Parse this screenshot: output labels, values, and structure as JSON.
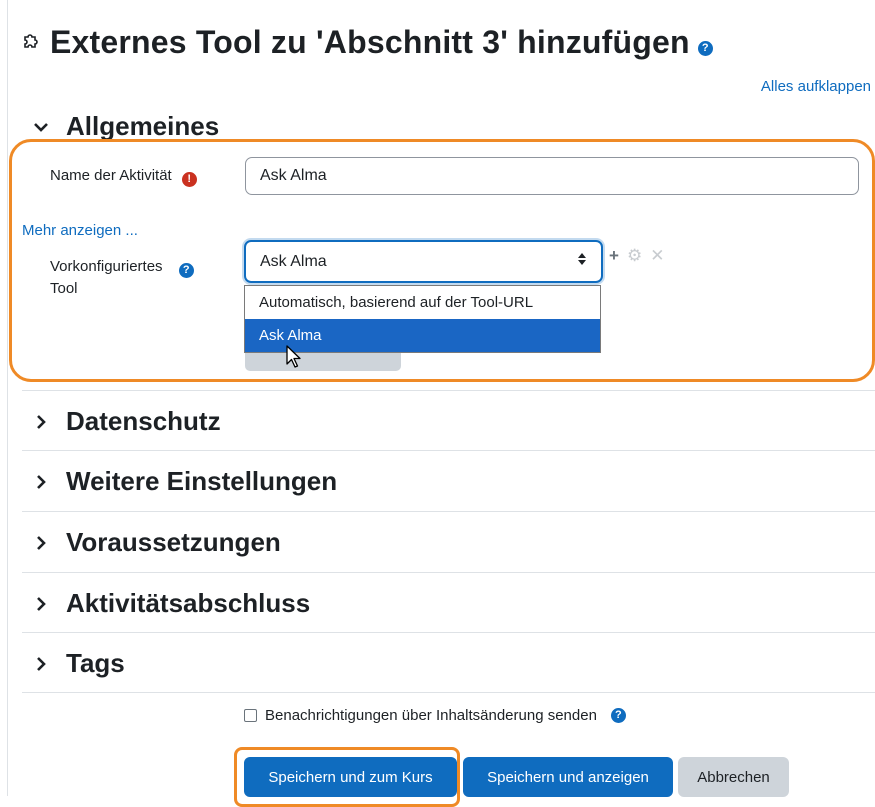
{
  "page": {
    "title": "Externes Tool zu 'Abschnitt 3' hinzufügen",
    "expand_all": "Alles aufklappen"
  },
  "sections": {
    "general": "Allgemeines",
    "privacy": "Datenschutz",
    "more_settings": "Weitere Einstellungen",
    "restrictions": "Voraussetzungen",
    "completion": "Aktivitätsabschluss",
    "tags": "Tags"
  },
  "form": {
    "name_label": "Name der Aktivität",
    "name_value": "Ask Alma",
    "show_more": "Mehr anzeigen ...",
    "preconfigured_label_line1": "Vorkonfiguriertes",
    "preconfigured_label_line2": "Tool",
    "preconfigured_value": "Ask Alma",
    "dropdown_options": [
      "Automatisch, basierend auf der Tool-URL",
      "Ask Alma"
    ],
    "notify_label": "Benachrichtigungen über Inhaltsänderung senden"
  },
  "buttons": {
    "save_return": "Speichern und zum Kurs",
    "save_display": "Speichern und anzeigen",
    "cancel": "Abbrechen"
  },
  "colors": {
    "link": "#0f6cbf",
    "primary": "#0f6cbf",
    "highlight": "#ef8a26",
    "required": "#ca3120"
  },
  "icons": {
    "title_icon": "puzzle-icon",
    "help": "question-circle-icon",
    "required": "exclamation-circle-icon",
    "add": "plus-icon",
    "edit": "gear-icon",
    "remove": "close-icon"
  }
}
